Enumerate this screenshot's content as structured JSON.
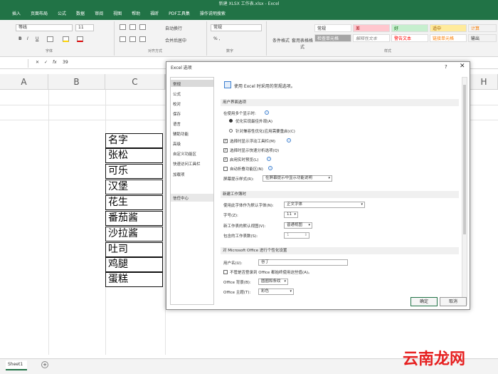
{
  "title": "新建 XLSX 工作表.xlsx - Excel",
  "tabs": [
    "插入",
    "页面布局",
    "公式",
    "数据",
    "审阅",
    "视图",
    "帮助",
    "福昕",
    "PDF工具集",
    "操作说明搜索"
  ],
  "ribbon": {
    "font_name": "等线",
    "font_size": "11",
    "wrap_text": "自动换行",
    "merge_center": "合并后居中",
    "number_format": "常规",
    "cond_format": "条件格式",
    "table_format": "套用表格格式",
    "styles": [
      "常规",
      "差",
      "好",
      "适中",
      "计算",
      "检查单元格",
      "解释性文本",
      "警告文本",
      "链接单元格",
      "输出"
    ],
    "groups": [
      "字体",
      "对齐方式",
      "数字",
      "样式"
    ]
  },
  "formula_bar": {
    "cell_ref": "39"
  },
  "columns": [
    "A",
    "B",
    "C",
    "H"
  ],
  "cells": [
    "名字",
    "张松",
    "可乐",
    "汉堡",
    "花生",
    "番茄酱",
    "沙拉酱",
    "吐司",
    "鸡腿",
    "蛋糕"
  ],
  "sheet_tab": "Sheet1",
  "dialog": {
    "title": "Excel 选项",
    "help": "?",
    "close": "✕",
    "nav": [
      "常规",
      "公式",
      "校对",
      "保存",
      "语言",
      "辅助功能",
      "高级",
      "自定义功能区",
      "快速访问工具栏",
      "加载项",
      "信任中心"
    ],
    "header": "使用 Excel 时采用的常规选项。",
    "sections": {
      "ui": "用户界面选项",
      "new_wb": "新建工作簿时",
      "personalize": "对 Microsoft Office 进行个性化设置"
    },
    "options": {
      "multi_display": "在使用多个显示时:",
      "opt_appearance": "优化实现最佳外观(A)",
      "opt_compat": "针对兼容性优化(应用需要重启)(C)",
      "mini_toolbar": "选择时显示浮动工具栏(M)",
      "quick_analysis": "选择时显示快速分析选项(Q)",
      "live_preview": "启用实时预览(L)",
      "collapse_ribbon": "自动折叠功能区(N)",
      "tooltip_style": "屏幕提示样式(R):",
      "tooltip_value": "在屏幕提示中显示功能说明",
      "default_font": "使用此字体作为默认字体(N):",
      "default_font_value": "正文字体",
      "font_size": "字号(Z):",
      "font_size_value": "11",
      "view": "新工作表的默认视图(V):",
      "view_value": "普通视图",
      "sheet_count": "包含的工作表数(S):",
      "sheet_count_value": "1",
      "username": "用户名(U):",
      "username_value": "谷丁",
      "always_use": "不管是否登录到 Office 都始终使用这些值(A)。",
      "office_bg": "Office 背景(B):",
      "office_bg_value": "圆圈和条纹",
      "office_theme": "Office 主题(T):",
      "office_theme_value": "彩色"
    },
    "ok": "确定",
    "cancel": "取消"
  },
  "watermark": "云南龙网"
}
